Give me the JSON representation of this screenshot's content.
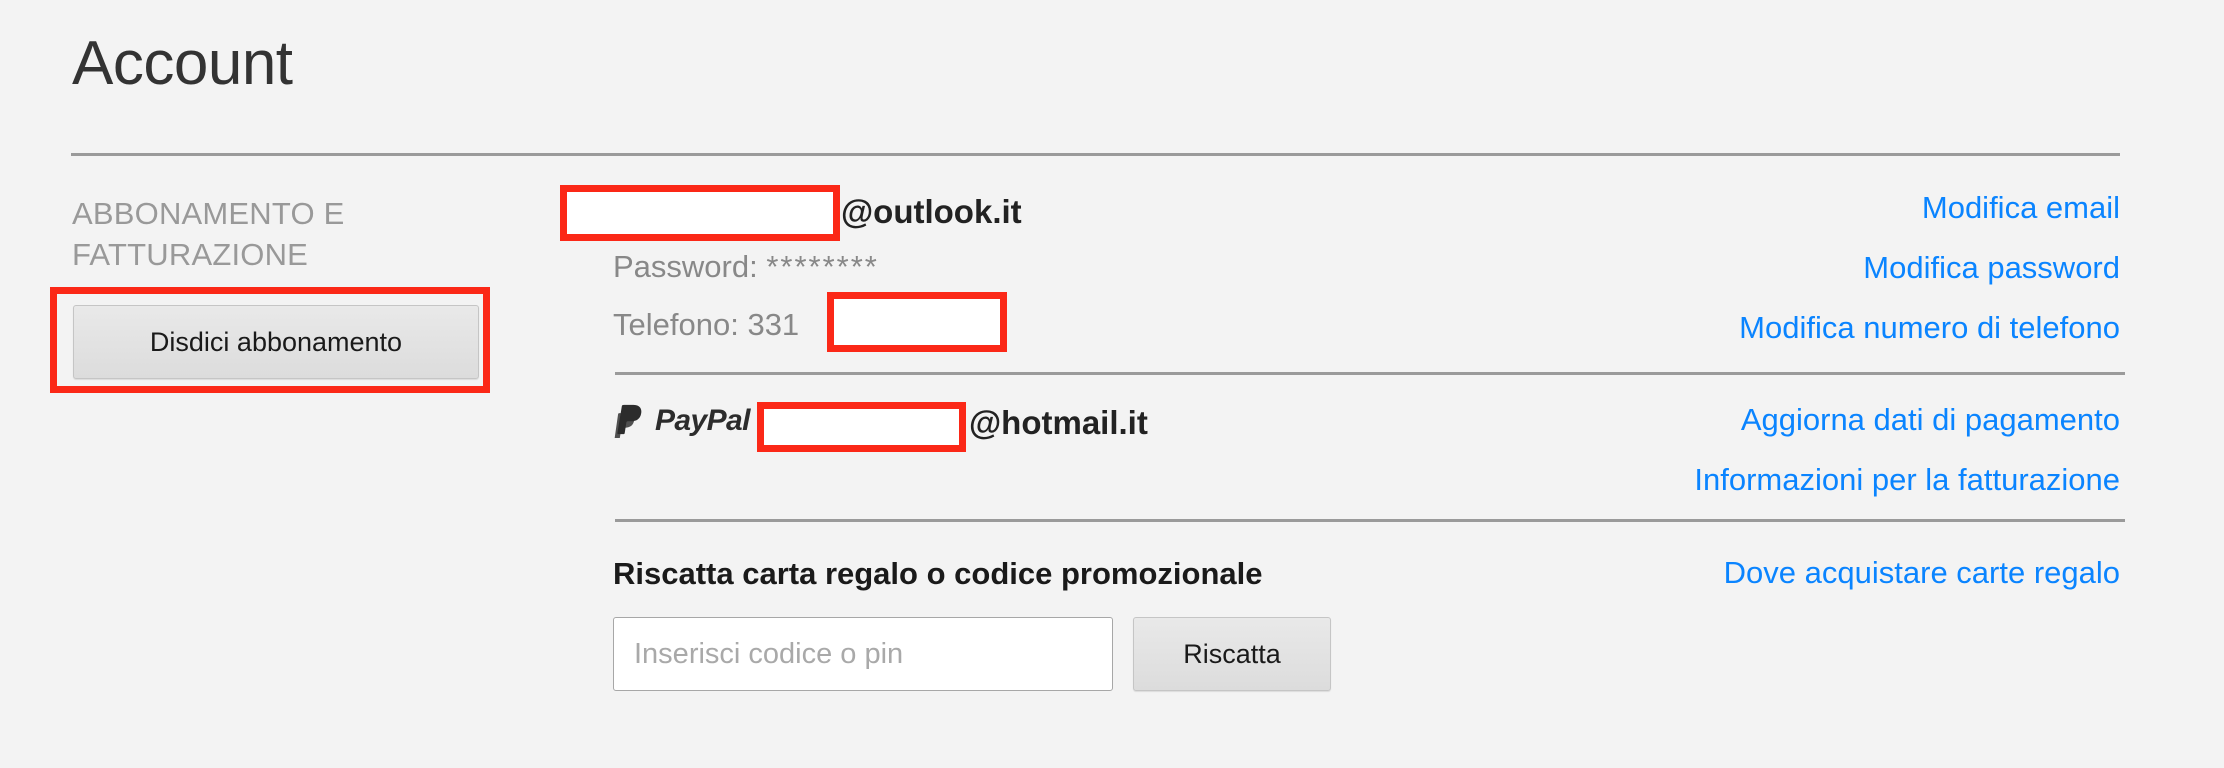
{
  "page": {
    "title": "Account",
    "background_color": "#f3f3f3",
    "link_color": "#0a84ff",
    "highlight_color": "#fb2817"
  },
  "sidebar": {
    "section_label": "ABBONAMENTO E FATTURAZIONE",
    "cancel_button_label": "Disdici abbonamento"
  },
  "account": {
    "email_redacted": "",
    "email_domain": "@outlook.it",
    "password_label": "Password:",
    "password_value": "********",
    "phone_label": "Telefono:",
    "phone_prefix": "331",
    "phone_redacted": ""
  },
  "payment": {
    "provider_name": "PayPal",
    "email_redacted": "",
    "email_domain": "@hotmail.it"
  },
  "redeem": {
    "title": "Riscatta carta regalo o codice promozionale",
    "input_value": "",
    "input_placeholder": "Inserisci codice o pin",
    "button_label": "Riscatta"
  },
  "links": {
    "edit_email": "Modifica email",
    "edit_password": "Modifica password",
    "edit_phone": "Modifica numero di telefono",
    "update_payment": "Aggiorna dati di pagamento",
    "billing_info": "Informazioni per la fatturazione",
    "where_to_buy_gift_cards": "Dove acquistare carte regalo"
  },
  "icons": {
    "paypal": "paypal-logo-icon"
  }
}
